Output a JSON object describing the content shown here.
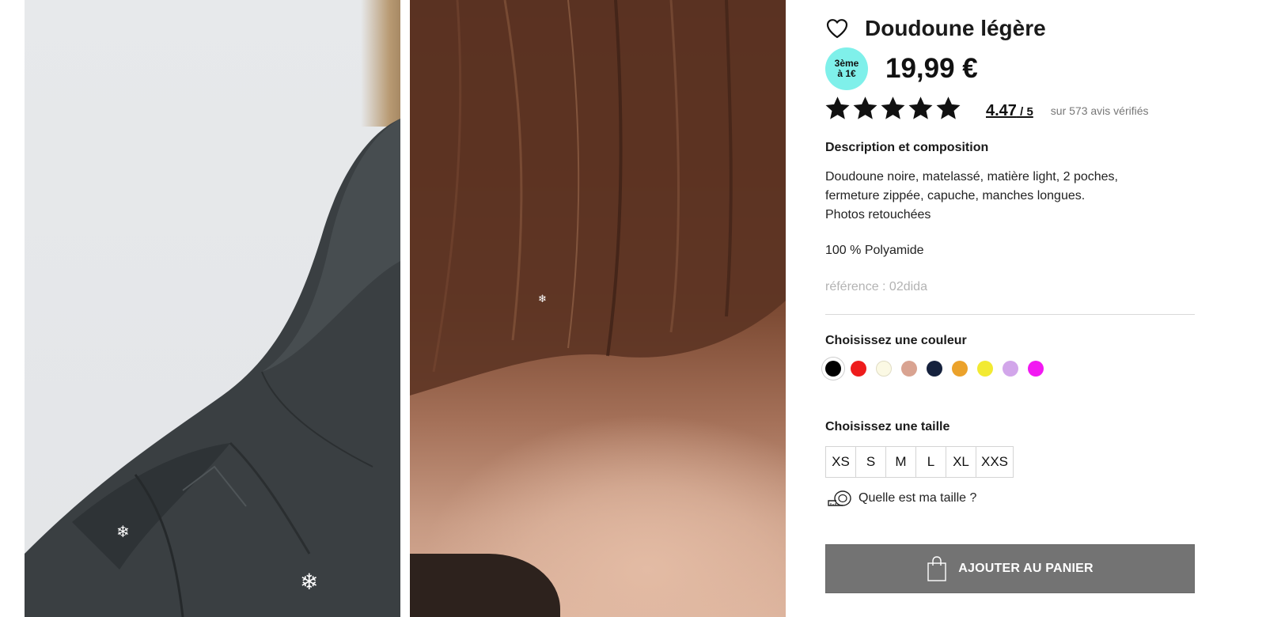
{
  "gallery": {
    "photos": [
      {
        "alt_icon": "jacket-shoulder-photo"
      },
      {
        "alt_icon": "hair-neck-photo"
      }
    ]
  },
  "product": {
    "title": "Doudoune légère",
    "promo_line1": "3ème",
    "promo_line2": "à 1€",
    "price": "19,99 €",
    "rating": {
      "stars_value": 5,
      "stars_max": 5,
      "score": "4.47",
      "out_of": " / 5",
      "count_text": "sur 573 avis vérifiés"
    },
    "description_title": "Description et composition",
    "description_line1": "Doudoune noire, matelassé, matière light, 2 poches,",
    "description_line2": "fermeture zippée, capuche, manches longues.",
    "description_line3": "Photos retouchées",
    "composition": "100 % Polyamide",
    "reference": "référence : 02dida"
  },
  "colors": {
    "title": "Choisissez une couleur",
    "selected_index": 0,
    "swatches": [
      "#000000",
      "#ee1c1c",
      "#fbf9e4",
      "#d9a391",
      "#15213d",
      "#eba22b",
      "#f2ea32",
      "#d2a6ea",
      "#f218f2"
    ]
  },
  "sizes": {
    "title": "Choisissez une taille",
    "options": [
      "XS",
      "S",
      "M",
      "L",
      "XL",
      "XXS"
    ]
  },
  "size_guide": {
    "label": "Quelle est ma taille ?"
  },
  "cart": {
    "label": "AJOUTER AU PANIER",
    "button_color": "#737373"
  },
  "icons": {
    "favorite": "heart-icon",
    "star": "star-icon",
    "size_guide": "measuring-tape-icon",
    "cart": "shopping-bag-icon",
    "decor": "snowflake-icon"
  }
}
